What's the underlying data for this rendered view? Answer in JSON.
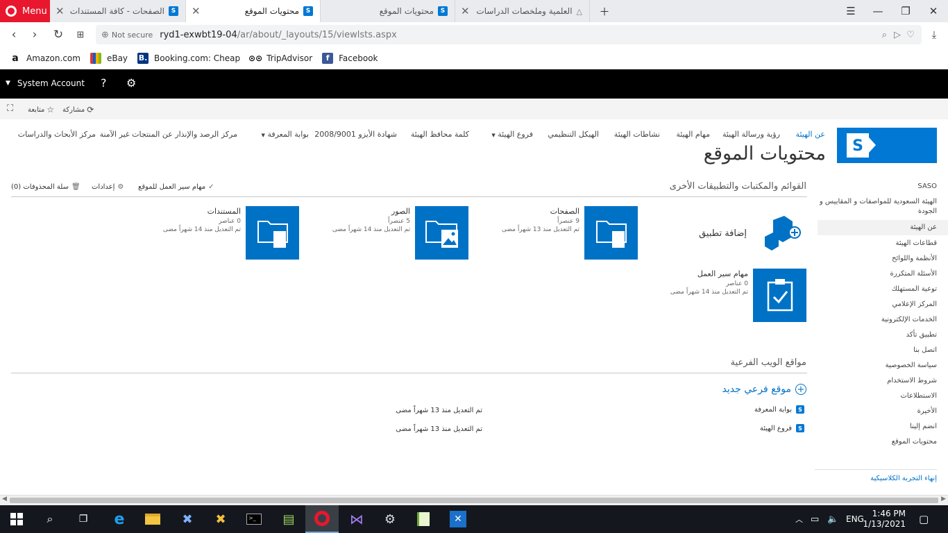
{
  "browser": {
    "menu_label": "Menu",
    "tabs": [
      {
        "title": "الصفحات - كافة المستندات"
      },
      {
        "title": "محتويات الموقع"
      },
      {
        "title": "محتويات الموقع"
      },
      {
        "title": "العلمية وملخصات الدراسات"
      }
    ],
    "not_secure": "Not secure",
    "url_host": "ryd1-exwbt19-04",
    "url_path": "/ar/about/_layouts/15/viewlsts.aspx",
    "bookmarks": [
      {
        "label": "Amazon.com"
      },
      {
        "label": "eBay"
      },
      {
        "label": "Booking.com: Cheap"
      },
      {
        "label": "TripAdvisor"
      },
      {
        "label": "Facebook"
      }
    ]
  },
  "suite": {
    "account": "System Account",
    "help": "?"
  },
  "ribbon": {
    "share": "مشاركة",
    "follow": "متابعة"
  },
  "topnav": {
    "home": "عن الهيئة",
    "items": [
      "رؤية ورسالة الهيئة",
      "مهام الهيئة",
      "نشاطات الهيئة",
      "الهيكل التنظيمي",
      "فروع الهيئة",
      "كلمة محافظ الهيئة",
      "شهادة الأيزو 2008/9001",
      "بوابة المعرفة",
      "مركز الرصد والإنذار عن المنتجات غير الآمنة",
      "مركز الأبحاث والدراسات"
    ]
  },
  "page": {
    "title": "محتويات الموقع",
    "lists_heading": "القوائم والمكتبات والتطبيقات الأخرى",
    "workflow_tasks_link": "مهام سير العمل للموقع",
    "settings_link": "إعدادات",
    "recycle_bin": "سلة المحذوفات (0)",
    "add_app": "إضافة تطبيق",
    "tiles": [
      {
        "name": "الصفحات",
        "count": "9 عنصراً",
        "modified": "تم التعديل منذ 13 شهراً مضى"
      },
      {
        "name": "الصور",
        "count": "5 عنصراً",
        "modified": "تم التعديل منذ 14 شهراً مضى"
      },
      {
        "name": "المستندات",
        "count": "0 عناصر",
        "modified": "تم التعديل منذ 14 شهراً مضى"
      },
      {
        "name": "مهام سير العمل",
        "count": "0 عناصر",
        "modified": "تم التعديل منذ 14 شهراً مضى"
      }
    ],
    "subsites_heading": "مواقع الويب الفرعية",
    "new_subsite": "موقع فرعي جديد",
    "subsites": [
      {
        "name": "بوابة المعرفة",
        "modified": "تم التعديل منذ 13 شهراً مضى"
      },
      {
        "name": "فروع الهيئة",
        "modified": "تم التعديل منذ 13 شهراً مضى"
      }
    ]
  },
  "leftnav": {
    "title": "SASO",
    "org_name": "الهيئة السعودية للمواصفات و المقاييس و الجودة",
    "items": [
      "عن الهيئة",
      "قطاعات الهيئة",
      "الأنظمة واللوائح",
      "الأسئلة المتكررة",
      "توعية المستهلك",
      "المركز الإعلامي",
      "الخدمات الإلكترونية",
      "تطبيق تأكد",
      "اتصل بنا",
      "سياسة الخصوصية",
      "شروط الاستخدام",
      "الاستطلاعات",
      "الأخيرة",
      "انضم إلينا",
      "محتويات الموقع"
    ],
    "end_classic": "إنهاء التجربة الكلاسيكية"
  },
  "taskbar": {
    "lang": "ENG",
    "time": "1:46 PM",
    "date": "1/13/2021"
  }
}
